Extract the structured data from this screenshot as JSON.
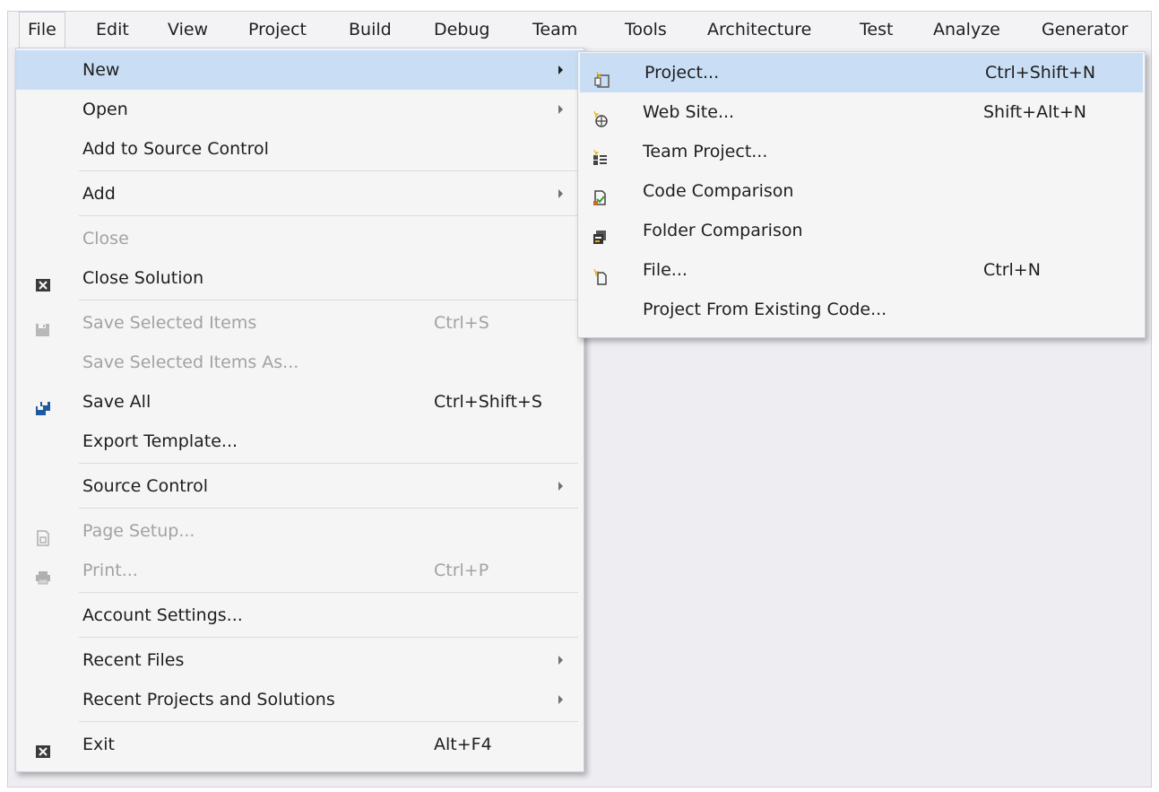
{
  "menubar": {
    "items": [
      "File",
      "Edit",
      "View",
      "Project",
      "Build",
      "Debug",
      "Team",
      "Tools",
      "Architecture",
      "Test",
      "Analyze",
      "Generator"
    ]
  },
  "file_menu": {
    "items": [
      {
        "label": "New",
        "shortcut": "",
        "submenu": true,
        "disabled": false,
        "highlighted": true,
        "icon": ""
      },
      {
        "label": "Open",
        "shortcut": "",
        "submenu": true,
        "disabled": false,
        "icon": ""
      },
      {
        "label": "Add to Source Control",
        "shortcut": "",
        "submenu": false,
        "disabled": false,
        "icon": ""
      },
      {
        "label": "Add",
        "shortcut": "",
        "submenu": true,
        "disabled": false,
        "icon": ""
      },
      {
        "label": "Close",
        "shortcut": "",
        "submenu": false,
        "disabled": true,
        "icon": ""
      },
      {
        "label": "Close Solution",
        "shortcut": "",
        "submenu": false,
        "disabled": false,
        "icon": "close-solution-icon"
      },
      {
        "label": "Save Selected Items",
        "shortcut": "Ctrl+S",
        "submenu": false,
        "disabled": true,
        "icon": "save-icon"
      },
      {
        "label": "Save Selected Items As...",
        "shortcut": "",
        "submenu": false,
        "disabled": true,
        "icon": ""
      },
      {
        "label": "Save All",
        "shortcut": "Ctrl+Shift+S",
        "submenu": false,
        "disabled": false,
        "icon": "save-all-icon"
      },
      {
        "label": "Export Template...",
        "shortcut": "",
        "submenu": false,
        "disabled": false,
        "icon": ""
      },
      {
        "label": "Source Control",
        "shortcut": "",
        "submenu": true,
        "disabled": false,
        "icon": ""
      },
      {
        "label": "Page Setup...",
        "shortcut": "",
        "submenu": false,
        "disabled": true,
        "icon": "page-setup-icon"
      },
      {
        "label": "Print...",
        "shortcut": "Ctrl+P",
        "submenu": false,
        "disabled": true,
        "icon": "print-icon"
      },
      {
        "label": "Account Settings...",
        "shortcut": "",
        "submenu": false,
        "disabled": false,
        "icon": ""
      },
      {
        "label": "Recent Files",
        "shortcut": "",
        "submenu": true,
        "disabled": false,
        "icon": ""
      },
      {
        "label": "Recent Projects and Solutions",
        "shortcut": "",
        "submenu": true,
        "disabled": false,
        "icon": ""
      },
      {
        "label": "Exit",
        "shortcut": "Alt+F4",
        "submenu": false,
        "disabled": false,
        "icon": "exit-icon"
      }
    ]
  },
  "new_submenu": {
    "items": [
      {
        "label": "Project...",
        "shortcut": "Ctrl+Shift+N",
        "icon": "new-project-icon",
        "highlighted": true
      },
      {
        "label": "Web Site...",
        "shortcut": "Shift+Alt+N",
        "icon": "new-web-site-icon"
      },
      {
        "label": "Team Project...",
        "shortcut": "",
        "icon": "team-project-icon"
      },
      {
        "label": "Code Comparison",
        "shortcut": "",
        "icon": "code-comparison-icon"
      },
      {
        "label": "Folder Comparison",
        "shortcut": "",
        "icon": "folder-comparison-icon"
      },
      {
        "label": "File...",
        "shortcut": "Ctrl+N",
        "icon": "new-file-icon"
      },
      {
        "label": "Project From Existing Code...",
        "shortcut": "",
        "icon": ""
      }
    ]
  },
  "colors": {
    "highlight": "#c9def5",
    "menu_bg": "#f5f5f5",
    "disabled_text": "#a2a2a2",
    "menubar_bg": "#f3f3f6"
  }
}
